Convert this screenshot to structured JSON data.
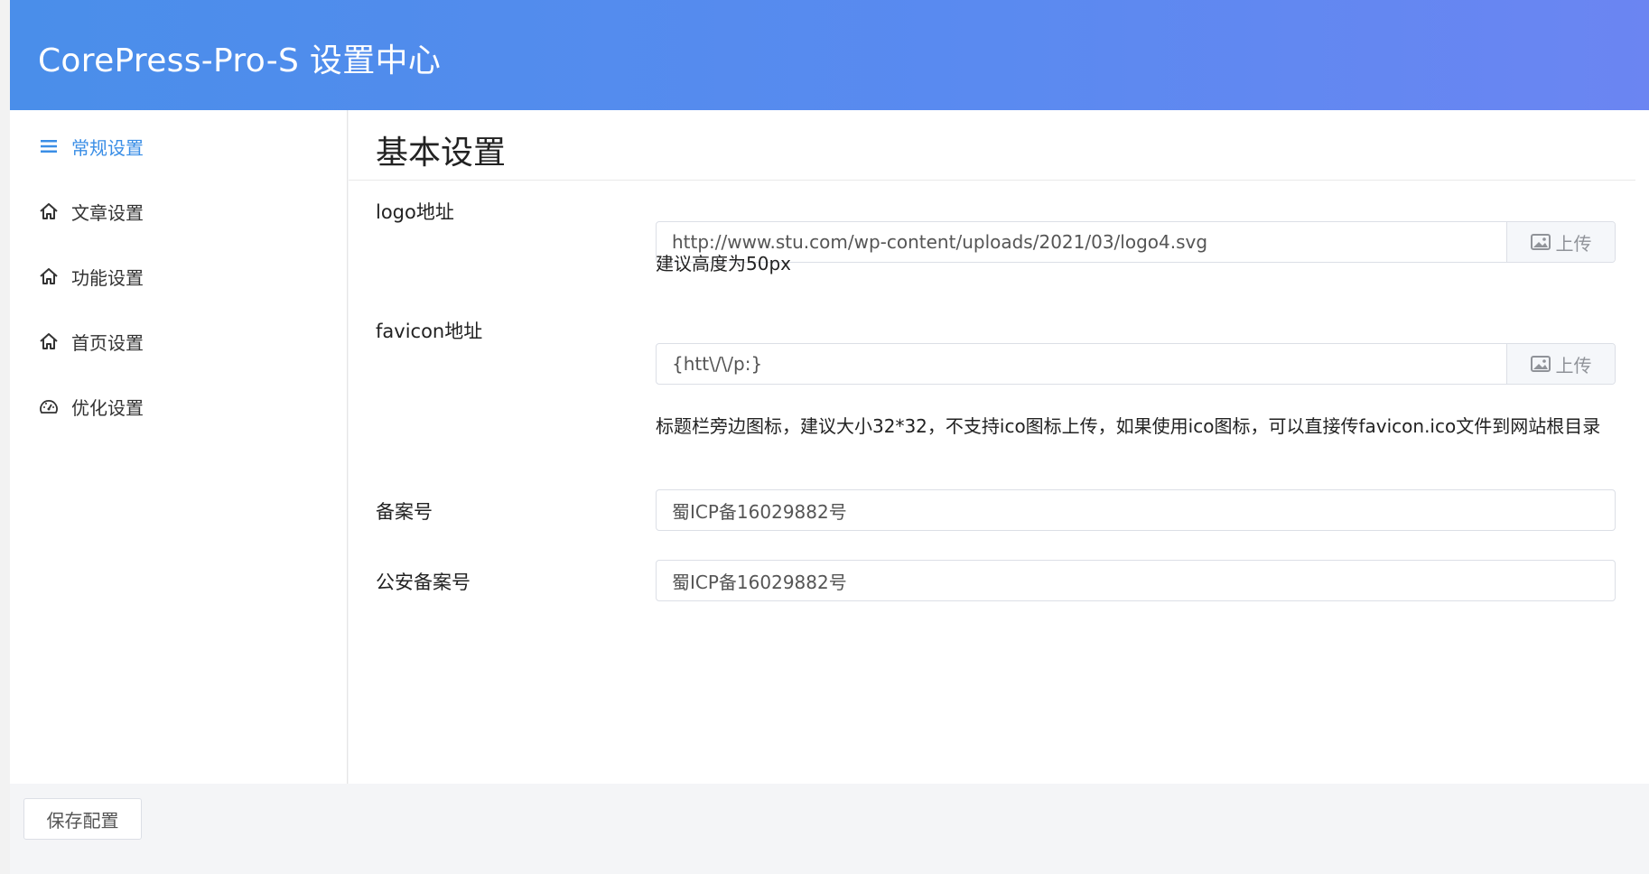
{
  "header": {
    "title": "CorePress-Pro-S 设置中心"
  },
  "sidebar": {
    "items": [
      {
        "label": "常规设置",
        "icon": "menu-icon",
        "active": true
      },
      {
        "label": "文章设置",
        "icon": "home-icon",
        "active": false
      },
      {
        "label": "功能设置",
        "icon": "home-icon",
        "active": false
      },
      {
        "label": "首页设置",
        "icon": "home-icon",
        "active": false
      },
      {
        "label": "优化设置",
        "icon": "dashboard-icon",
        "active": false
      }
    ]
  },
  "main": {
    "title": "基本设置",
    "fields": {
      "logo": {
        "label": "logo地址",
        "value": "http://www.stu.com/wp-content/uploads/2021/03/logo4.svg",
        "upload_label": "上传",
        "hint": "建议高度为50px"
      },
      "favicon": {
        "label": "favicon地址",
        "value": "{htt\\/\\/p:}",
        "upload_label": "上传",
        "hint": "标题栏旁边图标，建议大小32*32，不支持ico图标上传，如果使用ico图标，可以直接传favicon.ico文件到网站根目录"
      },
      "icp": {
        "label": "备案号",
        "value": "蜀ICP备16029882号"
      },
      "police": {
        "label": "公安备案号",
        "value": "蜀ICP备16029882号"
      }
    }
  },
  "footer": {
    "save_label": "保存配置"
  },
  "colors": {
    "header_start": "#4a8eea",
    "header_end": "#6b85f2",
    "accent": "#3a8ee6"
  }
}
